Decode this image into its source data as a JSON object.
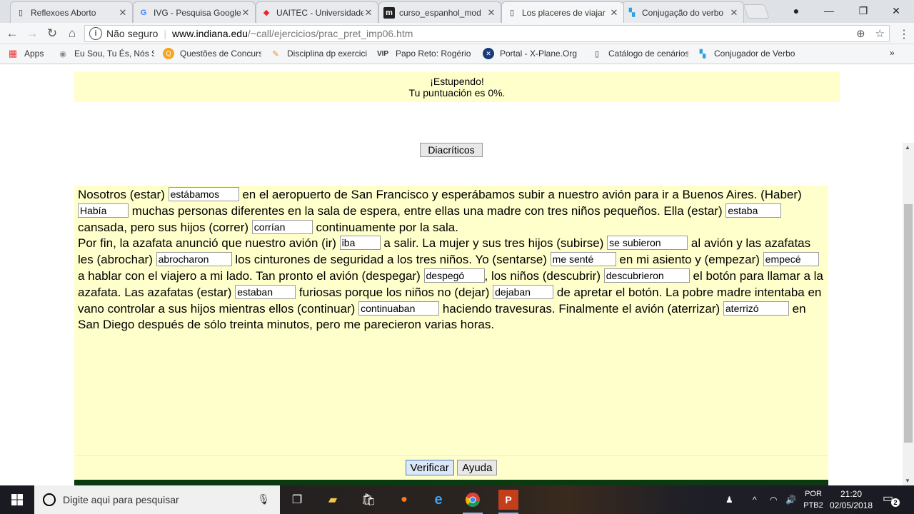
{
  "browser": {
    "tabs": [
      {
        "title": "Reflexoes Aborto",
        "icon": "document-icon"
      },
      {
        "title": "IVG - Pesquisa Google",
        "icon": "google-icon"
      },
      {
        "title": "UAITEC - Universidade",
        "icon": "uaitec-icon"
      },
      {
        "title": "curso_espanhol_mod",
        "icon": "moodle-icon"
      },
      {
        "title": "Los placeres de viajar",
        "icon": "document-icon"
      },
      {
        "title": "Conjugação do verbo",
        "icon": "conjugador-icon"
      }
    ],
    "address": {
      "security_label": "Não seguro",
      "host": "www.indiana.edu",
      "path": "/~call/ejercicios/prac_pret_imp06.htm"
    },
    "bookmarks": [
      {
        "label": "Apps",
        "icon": "apps-grid-icon"
      },
      {
        "label": "Eu Sou, Tu És, Nós Somos",
        "icon": "bookmark-favicon-icon"
      },
      {
        "label": "Questões de Concursos",
        "icon": "qc-icon"
      },
      {
        "label": "Disciplina dp exercicios",
        "icon": "graduation-cap-icon"
      },
      {
        "label": "Papo Reto: Rogério Fortes",
        "icon": "vip-icon"
      },
      {
        "label": "Portal - X-Plane.Org",
        "icon": "xplane-icon"
      },
      {
        "label": "Catálogo de cenários",
        "icon": "document-icon"
      },
      {
        "label": "Conjugador de Verbos",
        "icon": "conjugador-icon"
      }
    ]
  },
  "page": {
    "result": {
      "line1": "¡Estupendo!",
      "line2": "Tu puntuación es 0%."
    },
    "diacriticos_label": "Diacríticos",
    "exercise": {
      "t1": "Nosotros (estar)",
      "a1": "estábamos",
      "t2": "en el aeropuerto de San Francisco y esperábamos subir a nuestro avión para ir a Buenos Aires. (Haber)",
      "a2": "Había",
      "t3": "muchas personas diferentes en la sala de espera, entre ellas una madre con tres niños pequeños. Ella (estar)",
      "a3": "estaba",
      "t4": "cansada, pero sus hijos (correr)",
      "a4": "corrían",
      "t5": "continuamente por la sala.",
      "t6": "Por fin, la azafata anunció que nuestro avión (ir)",
      "a5": "iba",
      "t7": "a salir. La mujer y sus tres hijos (subirse)",
      "a6": "se subieron",
      "t8": "al avión y las azafatas les (abrochar)",
      "a7": "abrocharon",
      "t9": "los cinturones de seguridad a los tres niños. Yo (sentarse)",
      "a8": "me senté",
      "t10": "en mi asiento y (empezar)",
      "a9": "empecé",
      "t11": "a hablar con el viajero a mi lado. Tan pronto el avión (despegar)",
      "a10": "despegó",
      "t12": ", los niños (descubrir)",
      "a11": "descubrieron",
      "t13": "el botón para llamar a la azafata. Las azafatas (estar)",
      "a12": "estaban",
      "t14": "furiosas porque los niños no (dejar)",
      "a13": "dejaban",
      "t15": "de apretar el botón. La pobre madre intentaba en vano controlar a sus hijos mientras ellos (continuar)",
      "a14": "continuaban",
      "t16": "haciendo travesuras. Finalmente el avión (aterrizar)",
      "a15": "aterrizó",
      "t17": "en San Diego después de sólo treinta minutos, pero me parecieron varias horas."
    },
    "buttons": {
      "verify": "Verificar",
      "help": "Ayuda"
    }
  },
  "taskbar": {
    "search_placeholder": "Digite aqui para pesquisar",
    "lang_line1": "POR",
    "lang_line2": "PTB2",
    "time": "21:20",
    "date": "02/05/2018",
    "notification_count": "2"
  }
}
